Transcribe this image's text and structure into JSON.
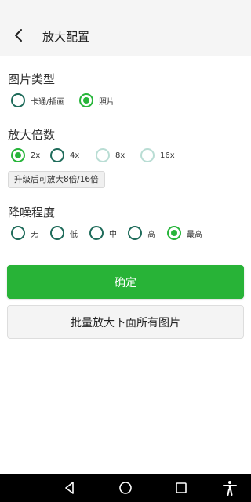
{
  "header": {
    "title": "放大配置",
    "back_icon": "back-arrow-icon"
  },
  "image_type": {
    "title": "图片类型",
    "options": [
      {
        "label": "卡通/插画",
        "checked": false,
        "disabled": false
      },
      {
        "label": "照片",
        "checked": true,
        "disabled": false
      }
    ]
  },
  "scale": {
    "title": "放大倍数",
    "options": [
      {
        "label": "2x",
        "checked": true,
        "disabled": false
      },
      {
        "label": "4x",
        "checked": false,
        "disabled": false
      },
      {
        "label": "8x",
        "checked": false,
        "disabled": true
      },
      {
        "label": "16x",
        "checked": false,
        "disabled": true
      }
    ],
    "upgrade_label": "升级后可放大8倍/16倍"
  },
  "denoise": {
    "title": "降噪程度",
    "options": [
      {
        "label": "无",
        "checked": false,
        "disabled": false
      },
      {
        "label": "低",
        "checked": false,
        "disabled": false
      },
      {
        "label": "中",
        "checked": false,
        "disabled": false
      },
      {
        "label": "高",
        "checked": false,
        "disabled": false
      },
      {
        "label": "最高",
        "checked": true,
        "disabled": false
      }
    ]
  },
  "actions": {
    "confirm_label": "确定",
    "batch_label": "批量放大下面所有图片"
  },
  "colors": {
    "accent": "#28b337",
    "radio_border": "#1e6b5a",
    "radio_disabled": "#b9ddd4",
    "header_bg": "#f5f5f5"
  },
  "navbar": {
    "icons": [
      "back-triangle-icon",
      "home-circle-icon",
      "recents-square-icon",
      "accessibility-icon"
    ]
  }
}
